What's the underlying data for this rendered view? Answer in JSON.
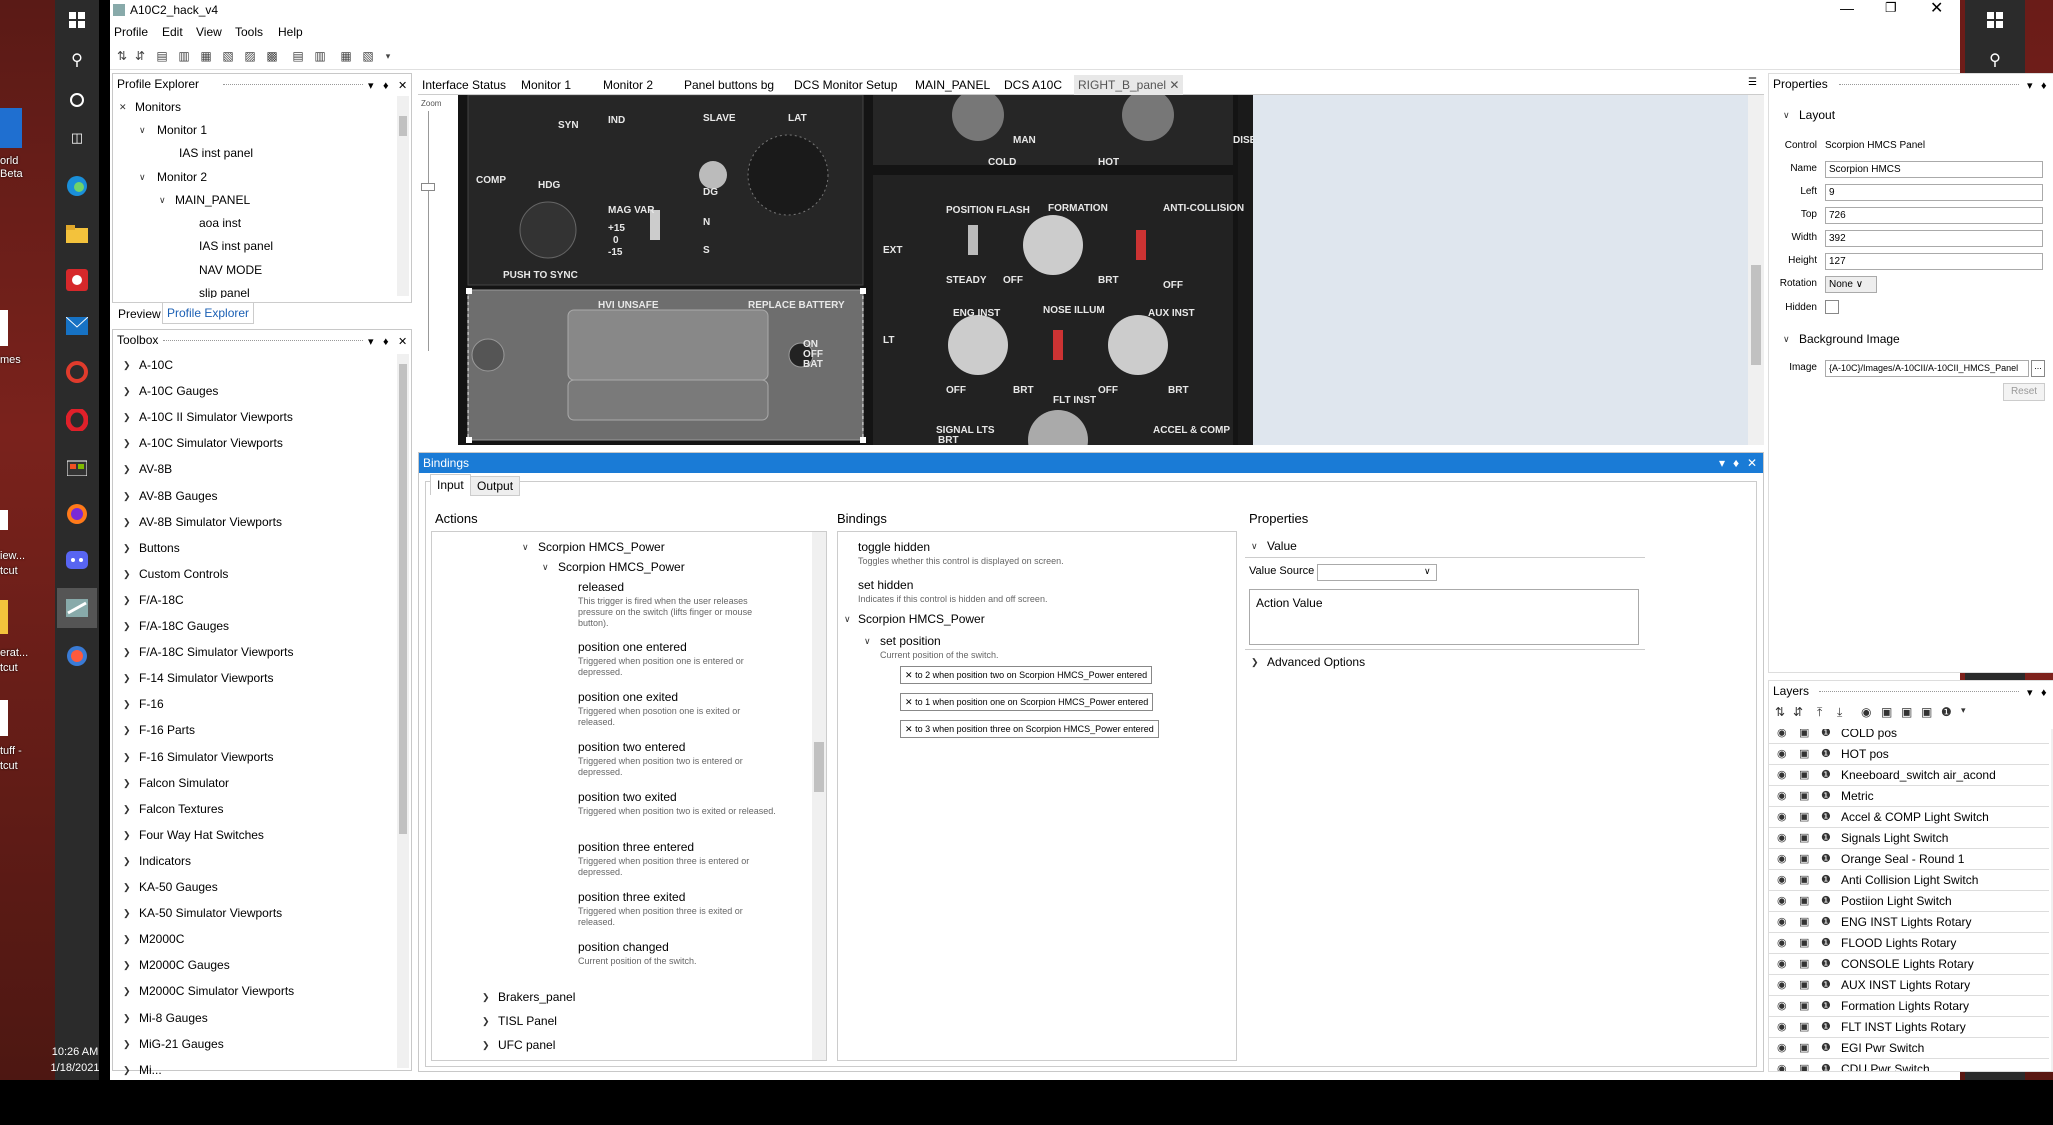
{
  "window": {
    "title": "A10C2_hack_v4"
  },
  "menu": [
    "Profile",
    "Edit",
    "View",
    "Tools",
    "Help"
  ],
  "desktop": {
    "left_labels": [
      "orld",
      "Beta",
      "mes",
      "iew...",
      "tcut",
      "erat...",
      "tcut",
      "tuff -",
      "tcut"
    ],
    "time": "10:26 AM",
    "date": "1/18/2021"
  },
  "profile_explorer": {
    "title": "Profile Explorer",
    "items": [
      "Monitors",
      "Monitor 1",
      "IAS inst panel",
      "Monitor 2",
      "MAIN_PANEL",
      "aoa inst",
      "IAS inst panel",
      "NAV MODE",
      "slip panel"
    ],
    "tabs": [
      "Preview",
      "Profile Explorer"
    ]
  },
  "toolbox": {
    "title": "Toolbox",
    "items": [
      "A-10C",
      "A-10C Gauges",
      "A-10C II Simulator Viewports",
      "A-10C Simulator Viewports",
      "AV-8B",
      "AV-8B Gauges",
      "AV-8B Simulator Viewports",
      "Buttons",
      "Custom Controls",
      "F/A-18C",
      "F/A-18C Gauges",
      "F/A-18C Simulator Viewports",
      "F-14 Simulator Viewports",
      "F-16",
      "F-16 Parts",
      "F-16 Simulator Viewports",
      "Falcon Simulator",
      "Falcon Textures",
      "Four Way Hat Switches",
      "Indicators",
      "KA-50 Gauges",
      "KA-50 Simulator Viewports",
      "M2000C",
      "M2000C Gauges",
      "M2000C Simulator Viewports",
      "Mi-8 Gauges",
      "MiG-21 Gauges",
      "Mi..."
    ]
  },
  "doc_tabs": [
    "Interface Status",
    "Monitor 1",
    "Monitor 2",
    "Panel buttons bg",
    "DCS Monitor Setup",
    "MAIN_PANEL",
    "DCS A10C",
    "RIGHT_B_panel"
  ],
  "zoom_label": "Zoom",
  "cockpit": {
    "labels": [
      "SYN",
      "IND",
      "SLAVE",
      "LAT",
      "HDG",
      "MAG VAR",
      "DG",
      "+15",
      "0",
      "-15",
      "N",
      "S",
      "PUSH TO SYNC",
      "COMP",
      "HVI UNSAFE",
      "REPLACE BATTERY",
      "ON",
      "OFF",
      "BAT",
      "MAN",
      "COLD",
      "HOT",
      "POSITION FLASH",
      "FORMATION",
      "ANTI-COLLISION",
      "STEADY",
      "OFF",
      "BRT",
      "OFF",
      "ENG INST",
      "NOSE ILLUM",
      "AUX INST",
      "OFF",
      "BRT",
      "OFF",
      "BRT",
      "EXT",
      "LT",
      "SIGNAL LTS",
      "BRT",
      "FLT INST",
      "ACCEL & COMP",
      "DISENGAGE"
    ]
  },
  "bindings": {
    "title": "Bindings",
    "tabs": [
      "Input",
      "Output"
    ],
    "actions_header": "Actions",
    "bindings_header": "Bindings",
    "properties_header": "Properties",
    "actions": [
      {
        "name": "Scorpion HMCS_Power"
      },
      {
        "name": "Scorpion HMCS_Power"
      },
      {
        "name": "released",
        "desc": "This trigger is fired when the user releases pressure on the switch (lifts finger or mouse button)."
      },
      {
        "name": "position one entered",
        "desc": "Triggered when position one is entered or depressed."
      },
      {
        "name": "position one exited",
        "desc": "Triggered when posotion one is exited or released."
      },
      {
        "name": "position two entered",
        "desc": "Triggered when position two is entered or depressed."
      },
      {
        "name": "position two exited",
        "desc": "Triggered when position two is exited or released."
      },
      {
        "name": "position three entered",
        "desc": "Triggered when position three is entered or depressed."
      },
      {
        "name": "position three exited",
        "desc": "Triggered when position three is exited or released."
      },
      {
        "name": "position changed",
        "desc": "Current position of the switch."
      },
      {
        "name": "Brakers_panel"
      },
      {
        "name": "TISL Panel"
      },
      {
        "name": "UFC panel"
      }
    ],
    "binding_items": [
      {
        "name": "toggle hidden",
        "desc": "Toggles whether this control is displayed on screen."
      },
      {
        "name": "set hidden",
        "desc": "Indicates if this control is hidden and off screen."
      },
      {
        "name": "Scorpion HMCS_Power"
      },
      {
        "name": "set position",
        "desc": "Current position of the switch."
      }
    ],
    "binding_rows": [
      "to 2 when position two on Scorpion HMCS_Power entered",
      "to 1 when position one on Scorpion HMCS_Power entered",
      "to 3 when position three on Scorpion HMCS_Power entered"
    ],
    "props": {
      "value_label": "Value",
      "value_source_label": "Value Source",
      "action_value": "Action Value",
      "advanced": "Advanced Options"
    }
  },
  "properties": {
    "title": "Properties",
    "layout": "Layout",
    "control_label": "Control",
    "control": "Scorpion HMCS Panel",
    "name_label": "Name",
    "name": "Scorpion HMCS",
    "left_label": "Left",
    "left": "9",
    "top_label": "Top",
    "top": "726",
    "width_label": "Width",
    "width": "392",
    "height_label": "Height",
    "height": "127",
    "rotation_label": "Rotation",
    "rotation": "None",
    "hidden_label": "Hidden",
    "bg_section": "Background Image",
    "image_label": "Image",
    "image": "{A-10C}/Images/A-10CII/A-10CII_HMCS_Panel",
    "reset": "Reset"
  },
  "layers": {
    "title": "Layers",
    "items": [
      "COLD pos",
      "HOT pos",
      "Kneeboard_switch air_acond",
      "Metric",
      "Accel & COMP  Light Switch",
      "Signals Light Switch",
      "Orange Seal - Round 1",
      "Anti Collision Light Switch",
      "Postiion Light Switch",
      "ENG INST Lights Rotary",
      "FLOOD Lights Rotary",
      "CONSOLE Lights Rotary",
      "AUX INST Lights Rotary",
      "Formation Lights Rotary",
      "FLT INST Lights Rotary",
      "EGI Pwr Switch",
      "CDU Pwr Switch"
    ]
  }
}
